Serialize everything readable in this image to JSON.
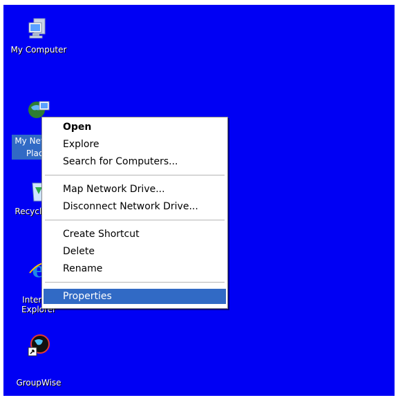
{
  "desktop": {
    "background": "#0000f4",
    "icons": [
      {
        "label": "My Computer",
        "icon": "my-computer-icon"
      },
      {
        "label": "My Network Places",
        "icon": "network-places-icon",
        "selected": true
      },
      {
        "label": "Recycle Bin",
        "icon": "recycle-bin-icon"
      },
      {
        "label": "Internet Explorer",
        "icon": "internet-explorer-icon"
      },
      {
        "label": "GroupWise",
        "icon": "groupwise-icon"
      }
    ]
  },
  "context_menu": {
    "items": [
      {
        "label": "Open",
        "bold": true
      },
      {
        "label": "Explore"
      },
      {
        "label": "Search for Computers..."
      },
      {
        "label": "Map Network Drive..."
      },
      {
        "label": "Disconnect Network Drive..."
      },
      {
        "label": "Create Shortcut"
      },
      {
        "label": "Delete"
      },
      {
        "label": "Rename"
      },
      {
        "label": "Properties",
        "highlighted": true
      }
    ],
    "highlight_color": "#316ac5"
  }
}
